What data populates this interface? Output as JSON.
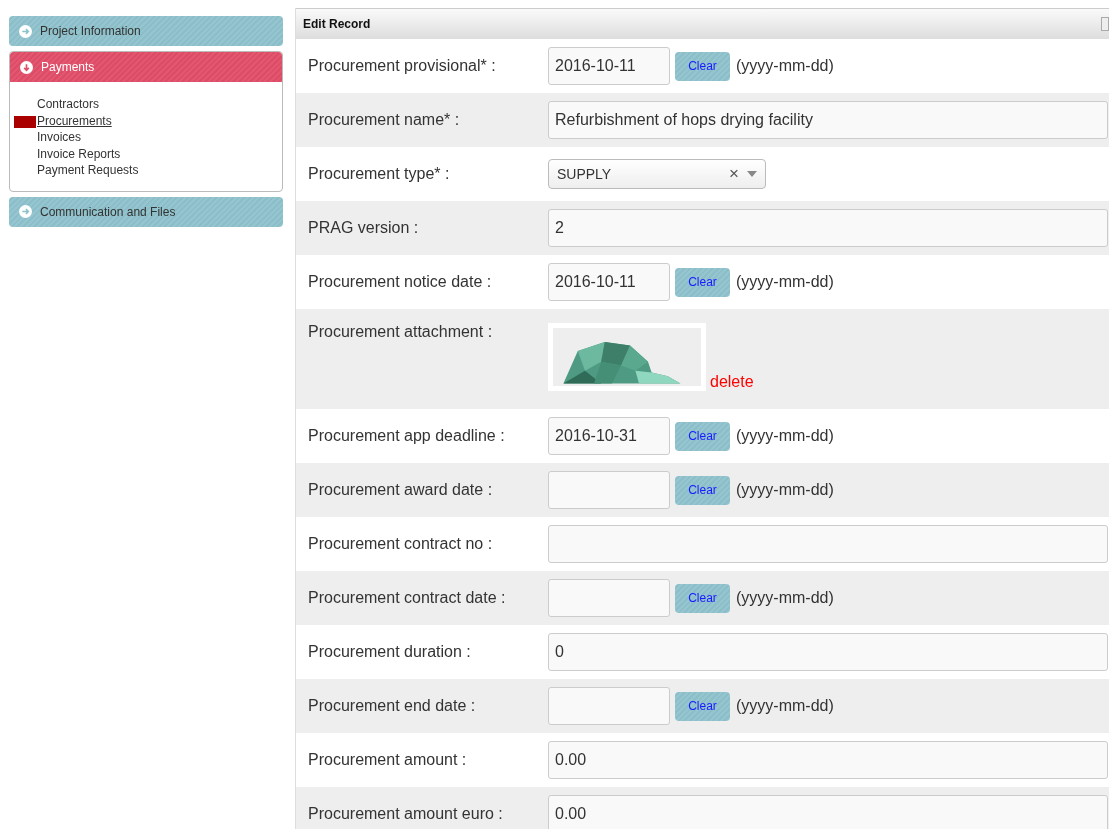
{
  "sidebar": {
    "sections": [
      {
        "title": "Project Information",
        "expanded": false
      },
      {
        "title": "Payments",
        "expanded": true,
        "items": [
          {
            "label": "Contractors",
            "selected": false
          },
          {
            "label": "Procurements",
            "selected": true
          },
          {
            "label": "Invoices",
            "selected": false
          },
          {
            "label": "Invoice Reports",
            "selected": false
          },
          {
            "label": "Payment Requests",
            "selected": false
          }
        ]
      },
      {
        "title": "Communication and Files",
        "expanded": false
      }
    ]
  },
  "panel": {
    "title": "Edit Record",
    "fields": [
      {
        "kind": "date",
        "label": "Procurement provisional* :",
        "value": "2016-10-11",
        "button": "Clear",
        "hint": "(yyyy-mm-dd)"
      },
      {
        "kind": "text",
        "label": "Procurement name* :",
        "value": "Refurbishment of hops drying facility"
      },
      {
        "kind": "select",
        "label": "Procurement type* :",
        "value": "SUPPLY",
        "clear_icon": "×"
      },
      {
        "kind": "text",
        "label": "PRAG version :",
        "value": "2"
      },
      {
        "kind": "date",
        "label": "Procurement notice date :",
        "value": "2016-10-11",
        "button": "Clear",
        "hint": "(yyyy-mm-dd)"
      },
      {
        "kind": "attachment",
        "label": "Procurement attachment :",
        "action": "delete"
      },
      {
        "kind": "date",
        "label": "Procurement app deadline :",
        "value": "2016-10-31",
        "button": "Clear",
        "hint": "(yyyy-mm-dd)"
      },
      {
        "kind": "date",
        "label": "Procurement award date :",
        "button": "Clear",
        "hint": "(yyyy-mm-dd)"
      },
      {
        "kind": "text",
        "label": "Procurement contract no :"
      },
      {
        "kind": "date",
        "label": "Procurement contract date :",
        "button": "Clear",
        "hint": "(yyyy-mm-dd)"
      },
      {
        "kind": "text",
        "label": "Procurement duration :",
        "value": "0"
      },
      {
        "kind": "date",
        "label": "Procurement end date :",
        "button": "Clear",
        "hint": "(yyyy-mm-dd)"
      },
      {
        "kind": "text",
        "label": "Procurement amount :",
        "value": "0.00"
      },
      {
        "kind": "text",
        "label": "Procurement amount euro :",
        "value": "0.00"
      }
    ]
  }
}
